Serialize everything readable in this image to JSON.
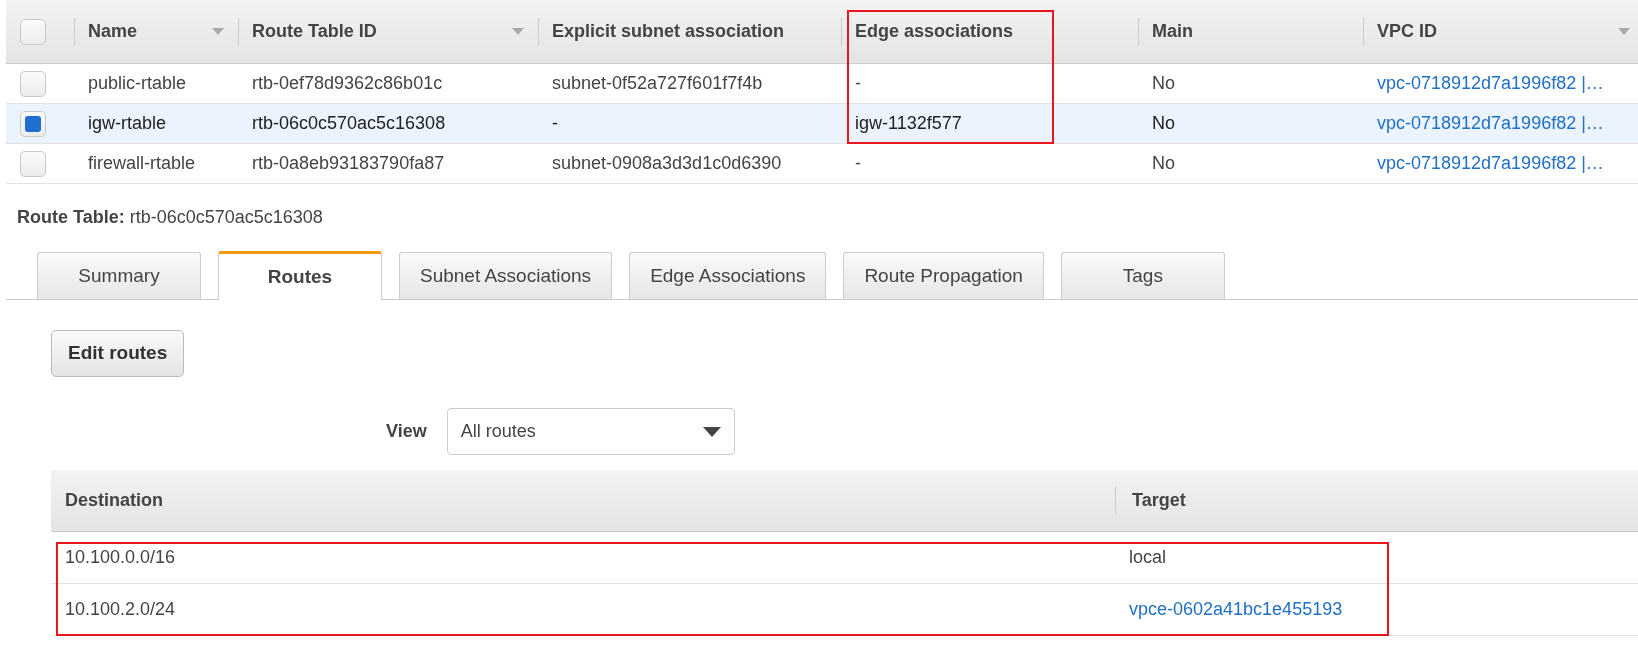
{
  "route_tables": {
    "all_selected": false,
    "columns": [
      {
        "label": "Name",
        "sortable": true,
        "highlighted": false
      },
      {
        "label": "Route Table ID",
        "sortable": true,
        "highlighted": false
      },
      {
        "label": "Explicit subnet association",
        "sortable": false,
        "highlighted": false
      },
      {
        "label": "Edge associations",
        "sortable": false,
        "highlighted": true
      },
      {
        "label": "Main",
        "sortable": false,
        "highlighted": false
      },
      {
        "label": "VPC ID",
        "sortable": true,
        "highlighted": false
      }
    ],
    "rows": [
      {
        "selected": false,
        "highlighted": true,
        "cells": [
          "public-rtable",
          "rtb-0ef78d9362c86b01c",
          "subnet-0f52a727f601f7f4b",
          "-",
          "No",
          "vpc-0718912d7a1996f82 |…"
        ]
      },
      {
        "selected": true,
        "highlighted": true,
        "cells": [
          "igw-rtable",
          "rtb-06c0c570ac5c16308",
          "-",
          "igw-1132f577",
          "No",
          "vpc-0718912d7a1996f82 |…"
        ]
      },
      {
        "selected": false,
        "highlighted": false,
        "cells": [
          "firewall-rtable",
          "rtb-0a8eb93183790fa87",
          "subnet-0908a3d3d1c0d6390",
          "-",
          "No",
          "vpc-0718912d7a1996f82 |…"
        ]
      }
    ]
  },
  "details": {
    "label": "Route Table:",
    "value": "rtb-06c0c570ac5c16308"
  },
  "tabs": [
    {
      "label": "Summary",
      "selected": false
    },
    {
      "label": "Routes",
      "selected": true
    },
    {
      "label": "Subnet Associations",
      "selected": false
    },
    {
      "label": "Edge Associations",
      "selected": false
    },
    {
      "label": "Route Propagation",
      "selected": false
    },
    {
      "label": "Tags",
      "selected": false
    }
  ],
  "edit_button": "Edit routes",
  "view": {
    "label": "View",
    "value": "All routes"
  },
  "routes": {
    "columns": [
      "Destination",
      "Target"
    ],
    "rows": [
      {
        "highlighted": true,
        "destination": "10.100.0.0/16",
        "target": "local",
        "target_link": false
      },
      {
        "highlighted": true,
        "destination": "10.100.2.0/24",
        "target": "vpce-0602a41bc1e455193",
        "target_link": true
      }
    ]
  }
}
